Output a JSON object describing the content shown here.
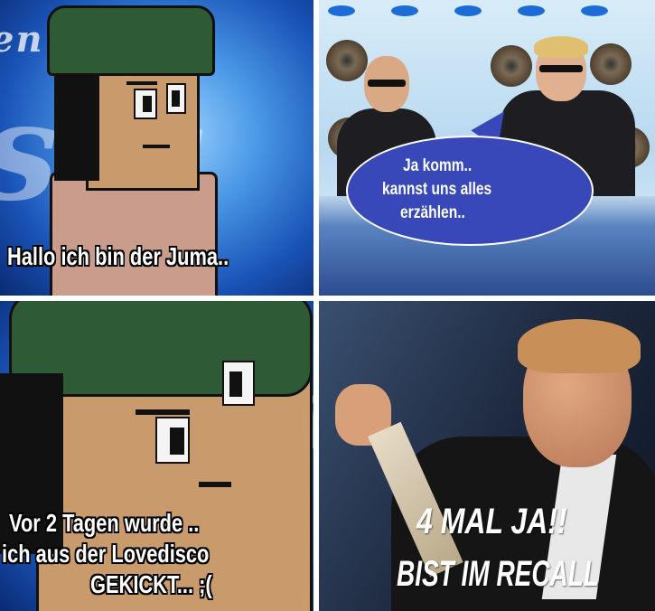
{
  "panels": [
    {
      "caption": "Hallo ich bin der Juma.."
    },
    {
      "speech": [
        "Ja komm..",
        "kannst uns alles",
        "erzählen.."
      ]
    },
    {
      "caption": [
        "Vor 2 Tagen wurde ..",
        "ich aus der Lovedisco",
        "GEKICKT... ;("
      ]
    },
    {
      "caption": [
        "4 MAL JA!!",
        "BIST IM RECALL"
      ]
    }
  ]
}
